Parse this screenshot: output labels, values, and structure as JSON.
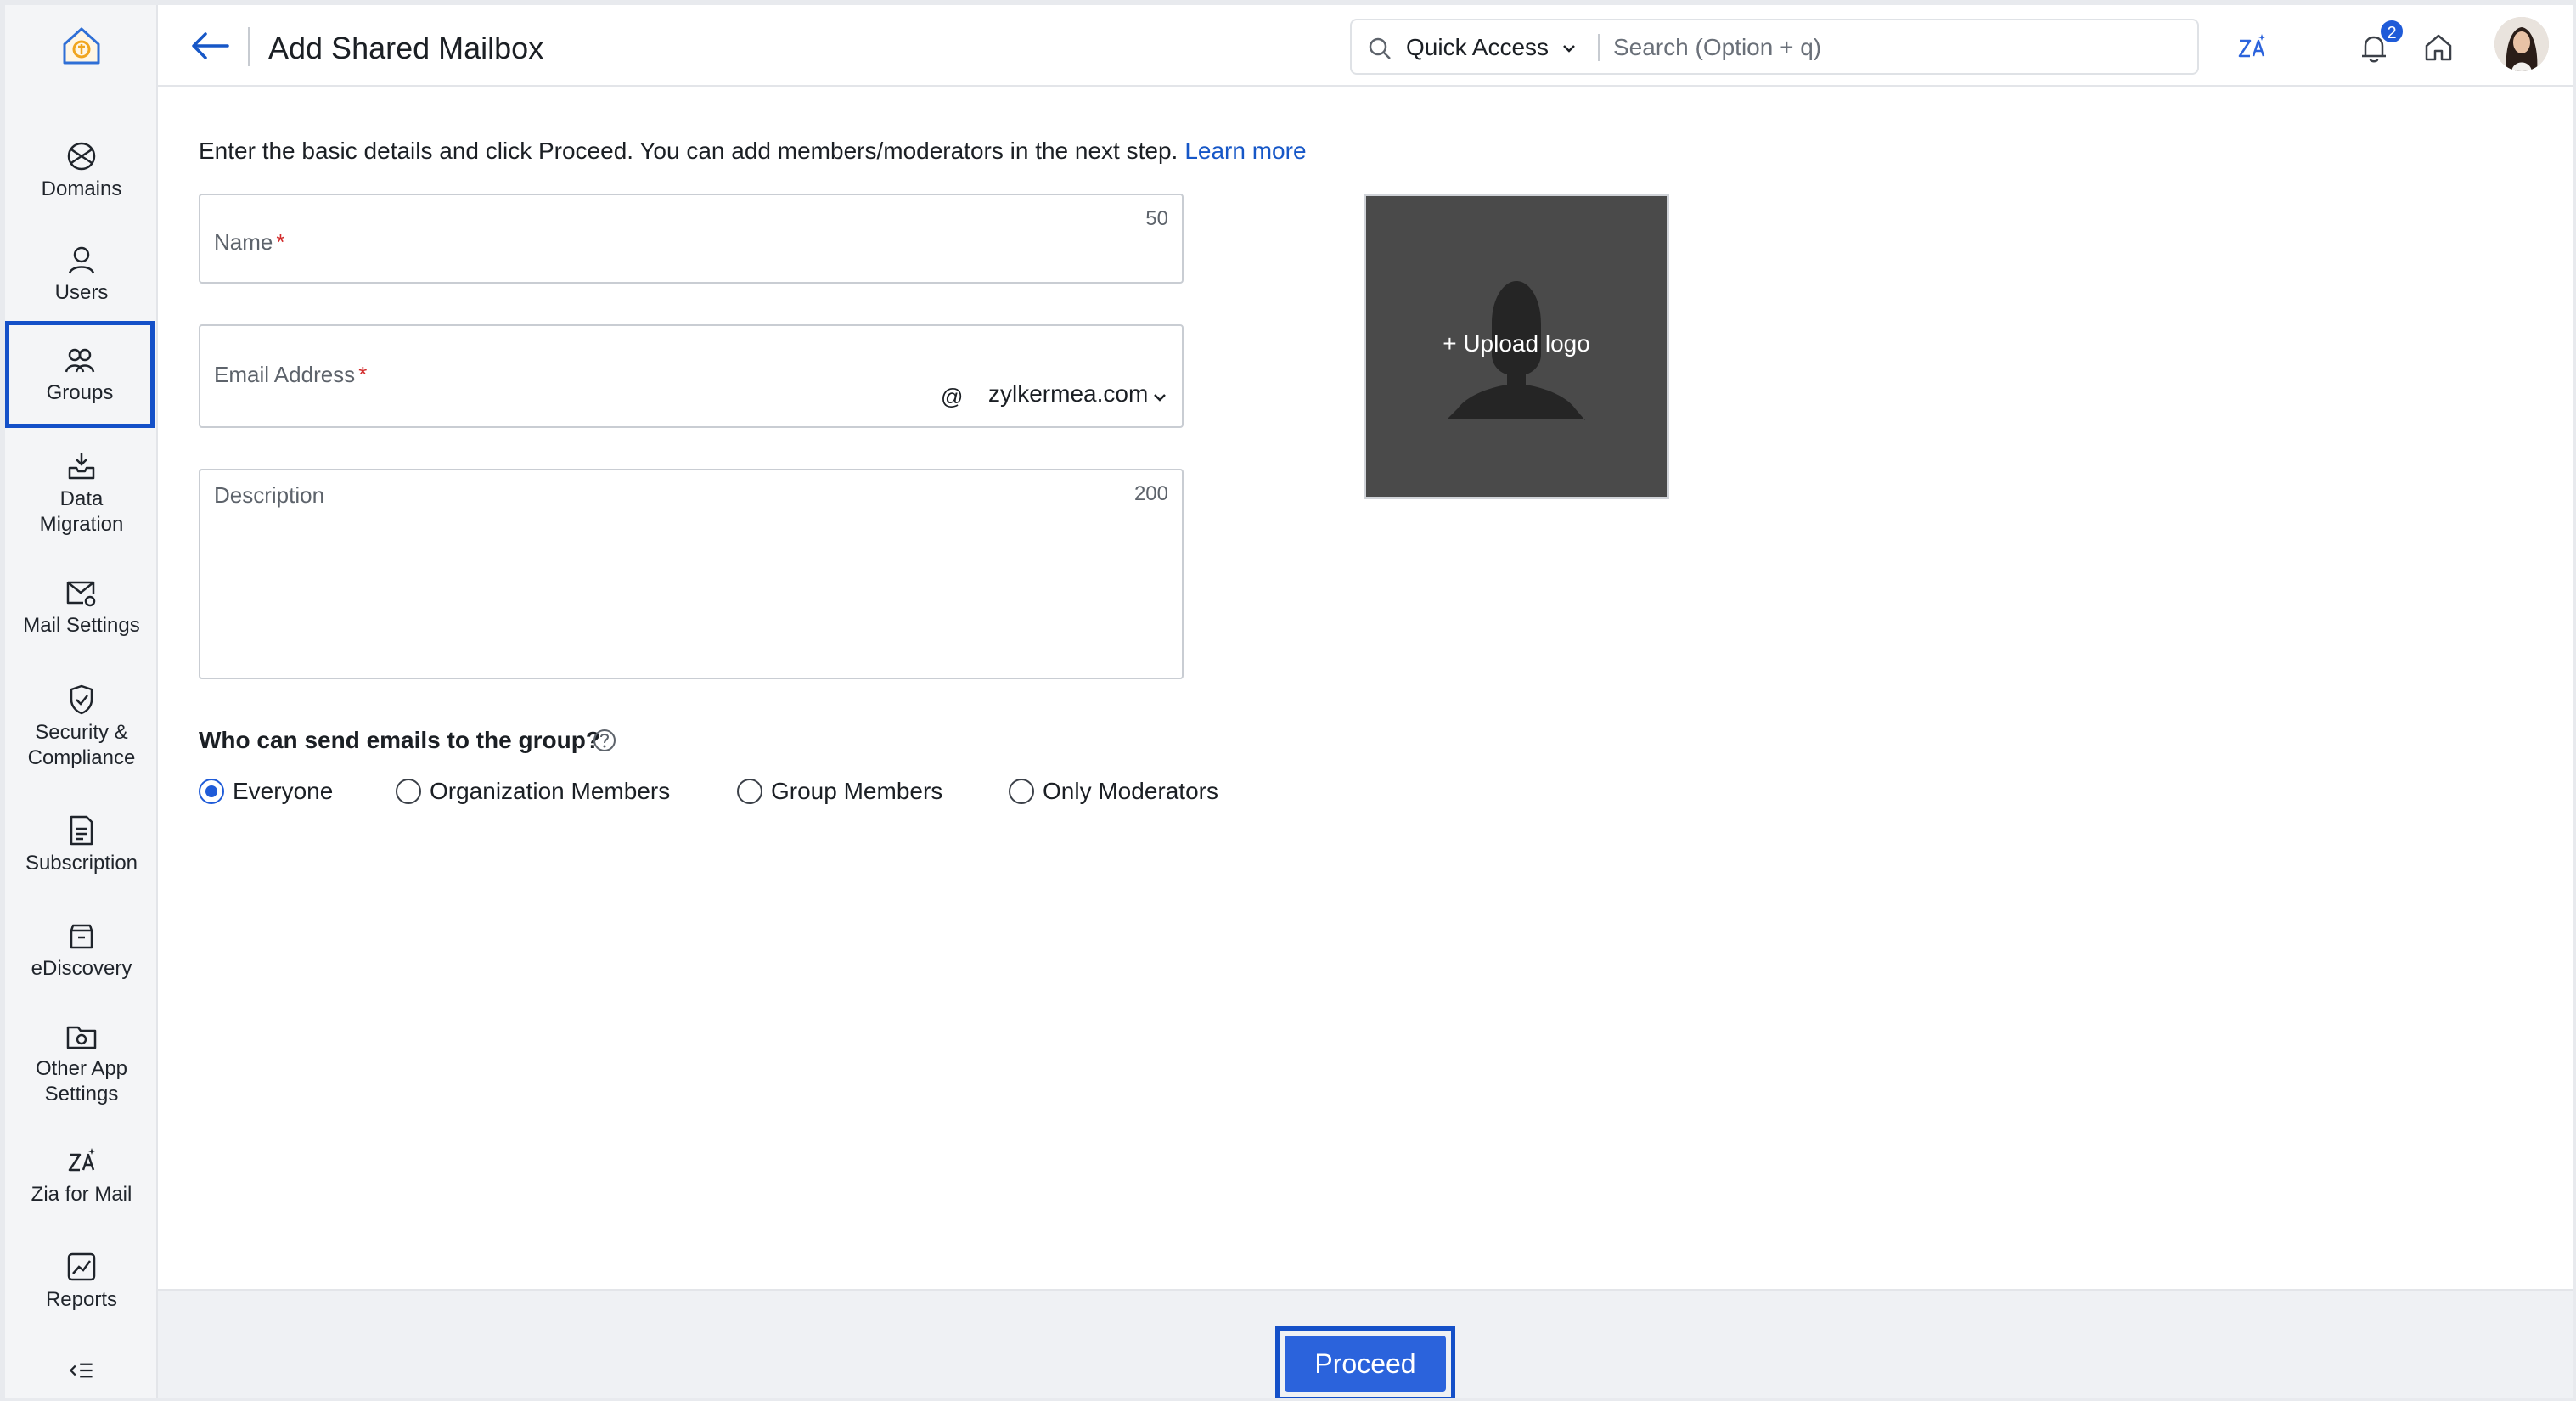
{
  "header": {
    "title": "Add Shared Mailbox",
    "quick_access_label": "Quick Access",
    "search_placeholder": "Search (Option + q)",
    "notification_count": "2"
  },
  "sidebar": {
    "items": [
      {
        "label": "Domains",
        "icon": "globe-icon",
        "active": false
      },
      {
        "label": "Users",
        "icon": "user-icon",
        "active": false
      },
      {
        "label": "Groups",
        "icon": "groups-icon",
        "active": true
      },
      {
        "label": "Data\nMigration",
        "icon": "inbox-download-icon",
        "active": false
      },
      {
        "label": "Mail Settings",
        "icon": "mail-gear-icon",
        "active": false
      },
      {
        "label": "Security &\nCompliance",
        "icon": "shield-check-icon",
        "active": false
      },
      {
        "label": "Subscription",
        "icon": "invoice-icon",
        "active": false
      },
      {
        "label": "eDiscovery",
        "icon": "archive-icon",
        "active": false
      },
      {
        "label": "Other App\nSettings",
        "icon": "folder-gear-icon",
        "active": false
      },
      {
        "label": "Zia for Mail",
        "icon": "zia-icon",
        "active": false
      },
      {
        "label": "Reports",
        "icon": "chart-icon",
        "active": false
      }
    ]
  },
  "form": {
    "intro_text": "Enter the basic details and click Proceed. You can add members/moderators in the next step.",
    "learn_more": "Learn more",
    "name_label": "Name",
    "name_counter": "50",
    "email_label": "Email Address",
    "at_symbol": "@",
    "domain_value": "zylkermea.com",
    "description_label": "Description",
    "description_counter": "200",
    "required_mark": "*",
    "upload_logo": "+ Upload logo",
    "question": "Who can send emails to the group?",
    "options": [
      {
        "label": "Everyone",
        "selected": true
      },
      {
        "label": "Organization Members",
        "selected": false
      },
      {
        "label": "Group Members",
        "selected": false
      },
      {
        "label": "Only Moderators",
        "selected": false
      }
    ]
  },
  "footer": {
    "proceed_label": "Proceed"
  },
  "colors": {
    "accent": "#2b63dc",
    "focus_outline": "#1450c8",
    "link": "#1657c7",
    "required": "#d22a2a"
  }
}
